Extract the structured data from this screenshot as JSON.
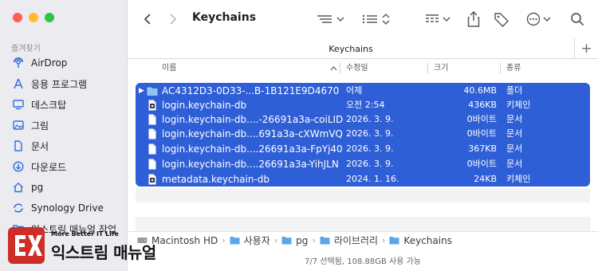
{
  "window": {
    "title": "Keychains"
  },
  "sidebar": {
    "section": "즐겨찾기",
    "items": [
      {
        "label": "AirDrop",
        "icon": "airdrop-icon"
      },
      {
        "label": "응용 프로그램",
        "icon": "applications-icon"
      },
      {
        "label": "데스크탑",
        "icon": "desktop-icon"
      },
      {
        "label": "그림",
        "icon": "pictures-icon"
      },
      {
        "label": "문서",
        "icon": "document-icon"
      },
      {
        "label": "다운로드",
        "icon": "downloads-icon"
      },
      {
        "label": "pg",
        "icon": "home-icon"
      },
      {
        "label": "Synology Drive",
        "icon": "synology-icon"
      },
      {
        "label": "익스트림 매뉴얼 작업",
        "icon": "folder-icon"
      }
    ]
  },
  "tabs": [
    {
      "label": "Keychains"
    }
  ],
  "columns": {
    "name": "이름",
    "date": "수정일",
    "size": "크기",
    "kind": "종류"
  },
  "files": [
    {
      "name": "AC4312D3-0D33-...B-1B121E9D4670",
      "date": "어제",
      "size": "40.6MB",
      "kind": "폴더",
      "icon": "folder-icon"
    },
    {
      "name": "login.keychain-db",
      "date": "오전 2:54",
      "size": "436KB",
      "kind": "키체인",
      "icon": "keychain-file-icon"
    },
    {
      "name": "login.keychain-db....-26691a3a-coiLID",
      "date": "2026. 3. 9.",
      "size": "0바이트",
      "kind": "문서",
      "icon": "document-icon"
    },
    {
      "name": "login.keychain-db....691a3a-cXWmVQ",
      "date": "2026. 3. 9.",
      "size": "0바이트",
      "kind": "문서",
      "icon": "document-icon"
    },
    {
      "name": "login.keychain-db....26691a3a-FpYj40",
      "date": "2026. 3. 9.",
      "size": "367KB",
      "kind": "문서",
      "icon": "document-icon"
    },
    {
      "name": "login.keychain-db....26691a3a-YihJLN",
      "date": "2026. 3. 9.",
      "size": "0바이트",
      "kind": "문서",
      "icon": "document-icon"
    },
    {
      "name": "metadata.keychain-db",
      "date": "2024. 1. 16.",
      "size": "24KB",
      "kind": "키체인",
      "icon": "keychain-file-icon"
    }
  ],
  "pathbar": [
    {
      "label": "Macintosh HD",
      "icon": "disk-icon"
    },
    {
      "label": "사용자",
      "icon": "folder-icon"
    },
    {
      "label": "pg",
      "icon": "folder-icon"
    },
    {
      "label": "라이브러리",
      "icon": "folder-icon"
    },
    {
      "label": "Keychains",
      "icon": "folder-icon"
    }
  ],
  "status": "7/7 선택됨, 108.88GB 사용 가능",
  "watermark": {
    "tagline": "More Better IT Life",
    "name": "익스트림 매뉴얼"
  },
  "colors": {
    "selection": "#2f5fd6",
    "sidebar": "#ecebf0",
    "folder": "#5aa7e8"
  }
}
